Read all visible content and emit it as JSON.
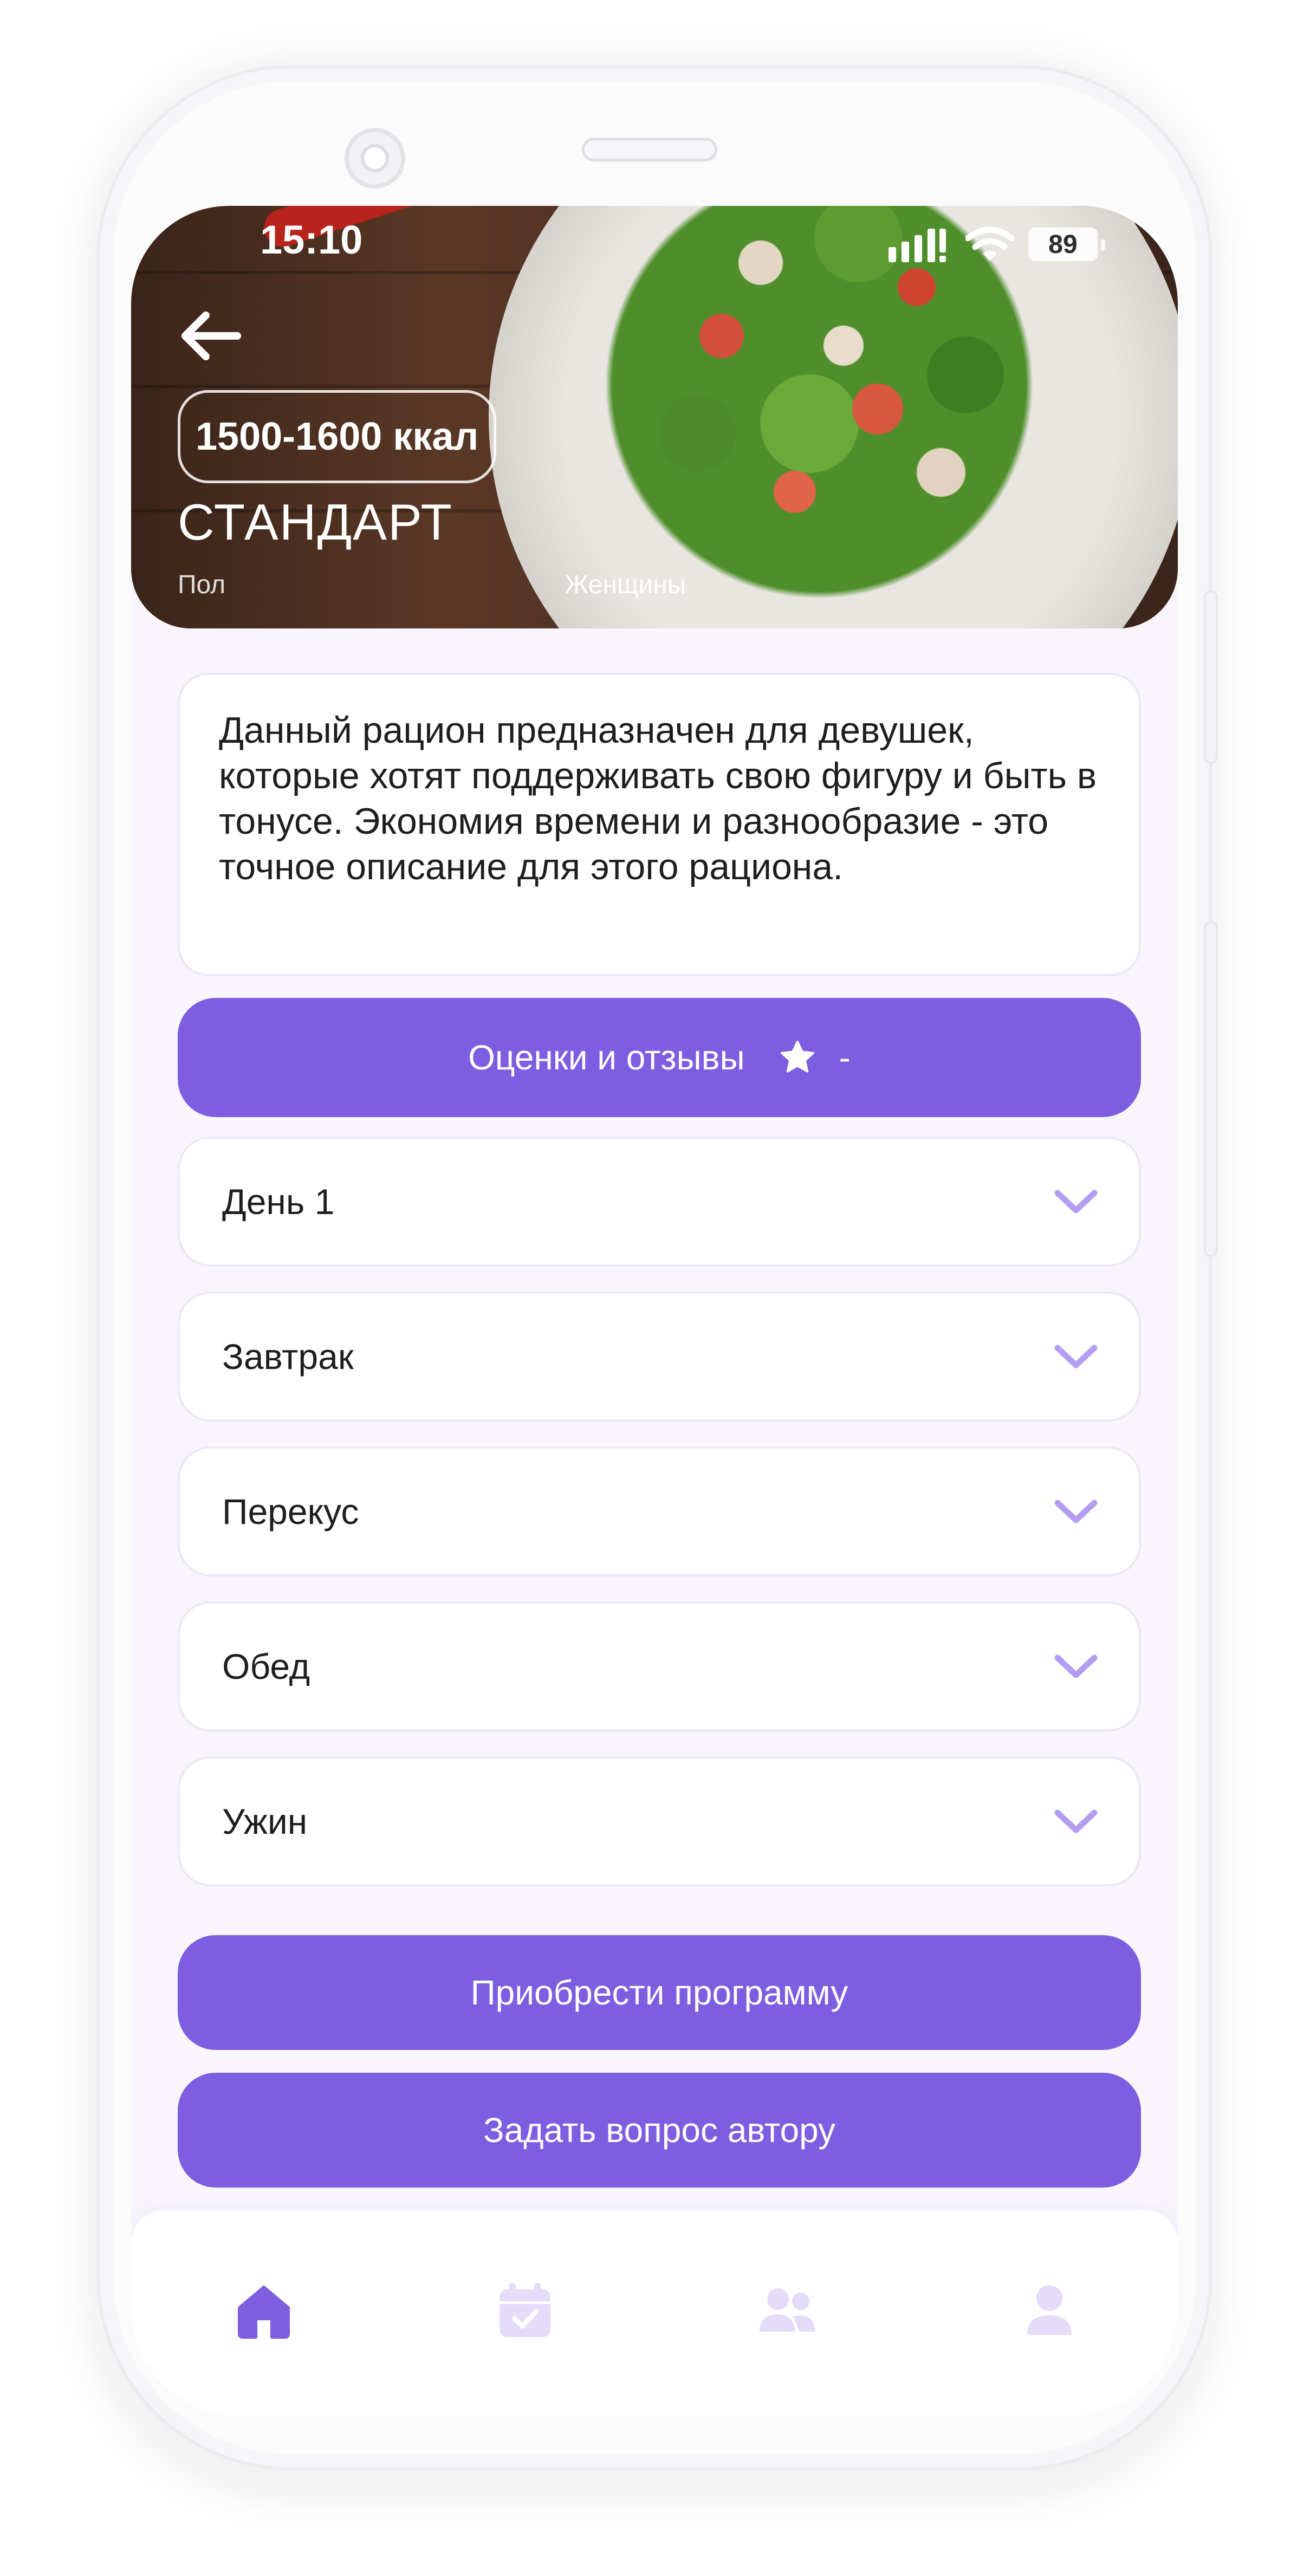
{
  "status_bar": {
    "time": "15:10",
    "battery": "89",
    "icons": [
      "signal-icon",
      "wifi-icon",
      "battery-icon"
    ]
  },
  "hero": {
    "back_icon": "arrow-left-icon",
    "kcal": "1500-1600 ккал",
    "title": "СТАНДАРТ",
    "gender_label": "Пол",
    "gender_value": "Женщины"
  },
  "description": "Данный рацион предназначен для девушек, которые хотят поддерживать свою фигуру и быть в тонусе. Экономия времени и разнообразие - это точное описание для этого рациона.",
  "reviews_button": {
    "label": "Оценки и отзывы",
    "icon": "star-icon",
    "rating": "-"
  },
  "accordion": [
    {
      "label": "День 1",
      "icon": "chevron-down-icon"
    },
    {
      "label": "Завтрак",
      "icon": "chevron-down-icon"
    },
    {
      "label": "Перекус",
      "icon": "chevron-down-icon"
    },
    {
      "label": "Обед",
      "icon": "chevron-down-icon"
    },
    {
      "label": "Ужин",
      "icon": "chevron-down-icon"
    }
  ],
  "actions": {
    "buy_label": "Приобрести программу",
    "ask_label": "Задать вопрос автору"
  },
  "bottom_nav": [
    {
      "name": "home",
      "icon": "home-icon",
      "active": true
    },
    {
      "name": "calendar",
      "icon": "calendar-icon",
      "active": false
    },
    {
      "name": "community",
      "icon": "users-icon",
      "active": false
    },
    {
      "name": "profile",
      "icon": "user-icon",
      "active": false
    }
  ],
  "colors": {
    "accent": "#7d5ee0",
    "accent_light": "#e4dcf8",
    "screen_bg": "#f8f5fd",
    "card_border": "#ece8f4",
    "text": "#1e1e1e"
  }
}
